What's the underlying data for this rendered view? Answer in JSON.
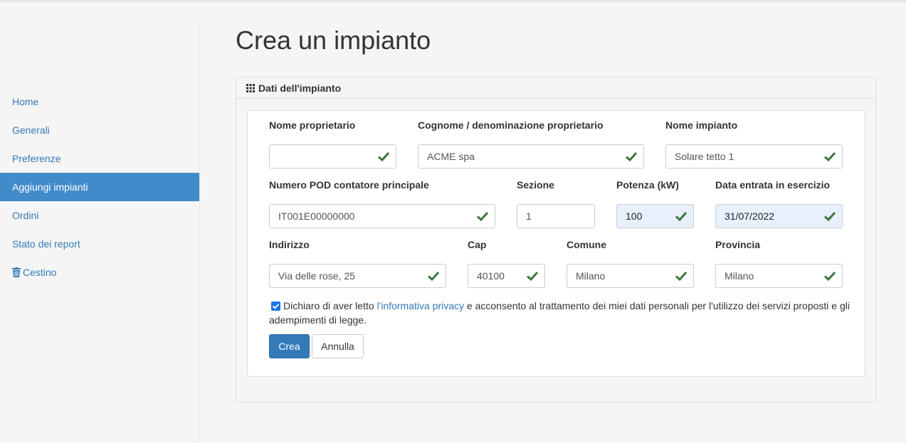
{
  "sidebar": {
    "items": [
      {
        "label": "Home"
      },
      {
        "label": "Generali"
      },
      {
        "label": "Preferenze"
      },
      {
        "label": "Aggiungi impianti"
      },
      {
        "label": "Ordini"
      },
      {
        "label": "Stato dei report"
      },
      {
        "label": "Cestino",
        "icon": "trash-icon"
      }
    ],
    "active_index": 3
  },
  "page": {
    "title": "Crea un impianto"
  },
  "panel": {
    "heading": "Dati dell'impianto",
    "heading_icon": "grid-icon"
  },
  "form": {
    "nome_proprietario": {
      "label": "Nome proprietario",
      "value": ""
    },
    "cognome_proprietario": {
      "label": "Cognome / denominazione proprietario",
      "value": "ACME spa"
    },
    "nome_impianto": {
      "label": "Nome impianto",
      "value": "Solare tetto 1"
    },
    "numero_pod": {
      "label": "Numero POD contatore principale",
      "value": "IT001E00000000"
    },
    "sezione": {
      "label": "Sezione",
      "value": "1"
    },
    "potenza": {
      "label": "Potenza (kW)",
      "value": "100"
    },
    "data_esercizio": {
      "label": "Data entrata in esercizio",
      "value": "31/07/2022"
    },
    "indirizzo": {
      "label": "Indirizzo",
      "value": "Via delle rose, 25"
    },
    "cap": {
      "label": "Cap",
      "value": "40100"
    },
    "comune": {
      "label": "Comune",
      "value": "Milano"
    },
    "provincia": {
      "label": "Provincia",
      "value": "Milano"
    }
  },
  "consent": {
    "checked": true,
    "text_before": "Dichiaro di aver letto ",
    "link_text": "l'informativa privacy",
    "text_after": " e acconsento al trattamento dei miei dati personali per l'utilizzo dei servizi proposti e gli adempimenti di legge."
  },
  "buttons": {
    "create": "Crea",
    "cancel": "Annulla"
  },
  "colors": {
    "primary": "#337ab7",
    "sidebar_active": "#428bca",
    "valid_check": "#3c763d",
    "autofill_bg": "#e8f0fe"
  }
}
